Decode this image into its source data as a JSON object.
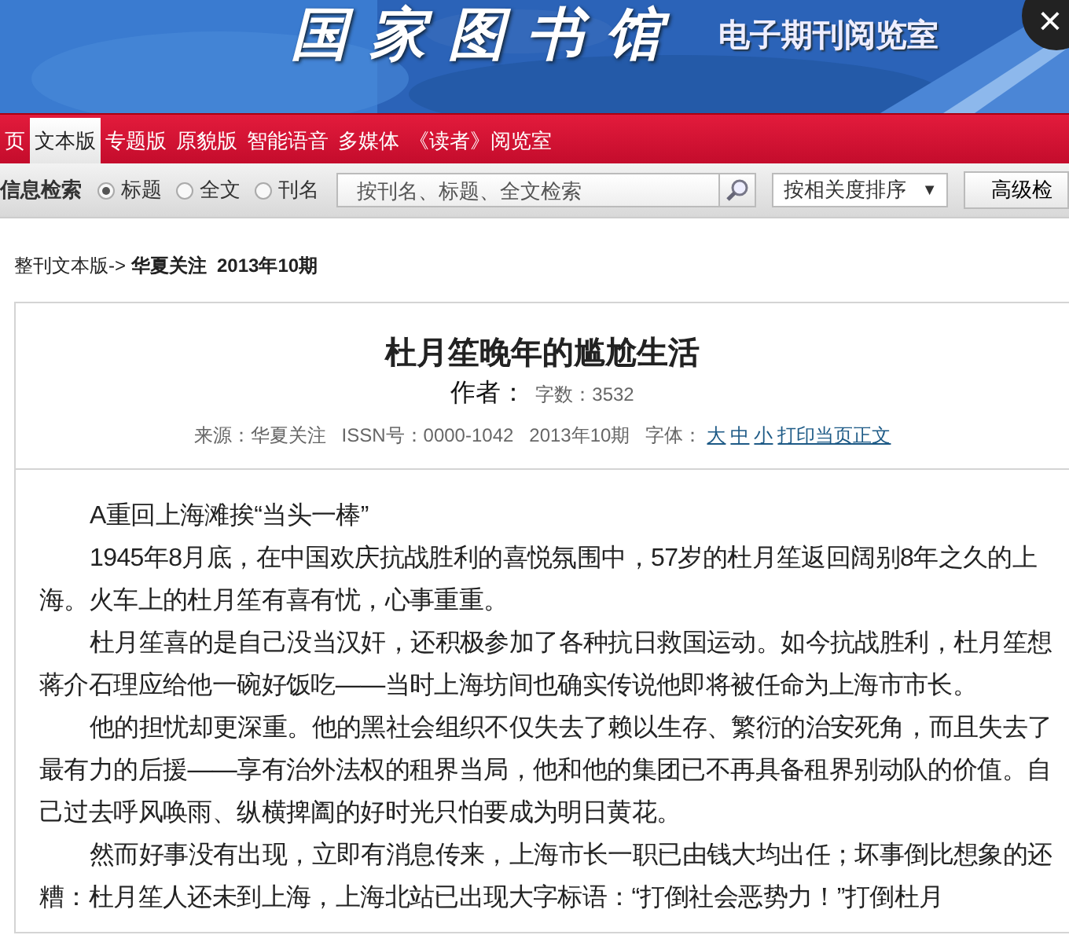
{
  "banner": {
    "logo": "国家图书馆",
    "subtitle": "电子期刊阅览室",
    "close": "×"
  },
  "nav": [
    {
      "label": "页",
      "selected": false
    },
    {
      "label": "文本版",
      "selected": true
    },
    {
      "label": "专题版",
      "selected": false
    },
    {
      "label": "原貌版",
      "selected": false
    },
    {
      "label": "智能语音",
      "selected": false
    },
    {
      "label": "多媒体",
      "selected": false
    },
    {
      "label": "《读者》阅览室",
      "selected": false
    }
  ],
  "search": {
    "label": "信息检索",
    "scopes": [
      {
        "label": "标题",
        "selected": true
      },
      {
        "label": "全文",
        "selected": false
      },
      {
        "label": "刊名",
        "selected": false
      }
    ],
    "placeholder": "按刊名、标题、全文检索",
    "sort": "按相关度排序",
    "sort_caret": "▼",
    "advanced": "高级检"
  },
  "breadcrumb": {
    "path": "整刊文本版-> ",
    "current": "华夏关注  2013年10期"
  },
  "article": {
    "title": "杜月笙晚年的尴尬生活",
    "author_label": "作者：",
    "word_count": "字数：3532",
    "meta": "来源：华夏关注   ISSN号：0000-1042   2013年10期   字体：",
    "font_links": [
      "大",
      "中",
      "小"
    ],
    "print_link": "打印当页正文",
    "paragraphs": [
      "A重回上海滩挨“当头一棒”",
      "1945年8月底，在中国欢庆抗战胜利的喜悦氛围中，57岁的杜月笙返回阔别8年之久的上海。火车上的杜月笙有喜有忧，心事重重。",
      "杜月笙喜的是自己没当汉奸，还积极参加了各种抗日救国运动。如今抗战胜利，杜月笙想蒋介石理应给他一碗好饭吃——当时上海坊间也确实传说他即将被任命为上海市市长。",
      "他的担忧却更深重。他的黑社会组织不仅失去了赖以生存、繁衍的治安死角，而且失去了最有力的后援——享有治外法权的租界当局，他和他的集团已不再具备租界别动队的价值。自己过去呼风唤雨、纵横捭阖的好时光只怕要成为明日黄花。",
      "然而好事没有出现，立即有消息传来，上海市长一职已由钱大均出任；坏事倒比想象的还糟：杜月笙人还未到上海，上海北站已出现大字标语：“打倒社会恶势力！”打倒杜月"
    ]
  }
}
